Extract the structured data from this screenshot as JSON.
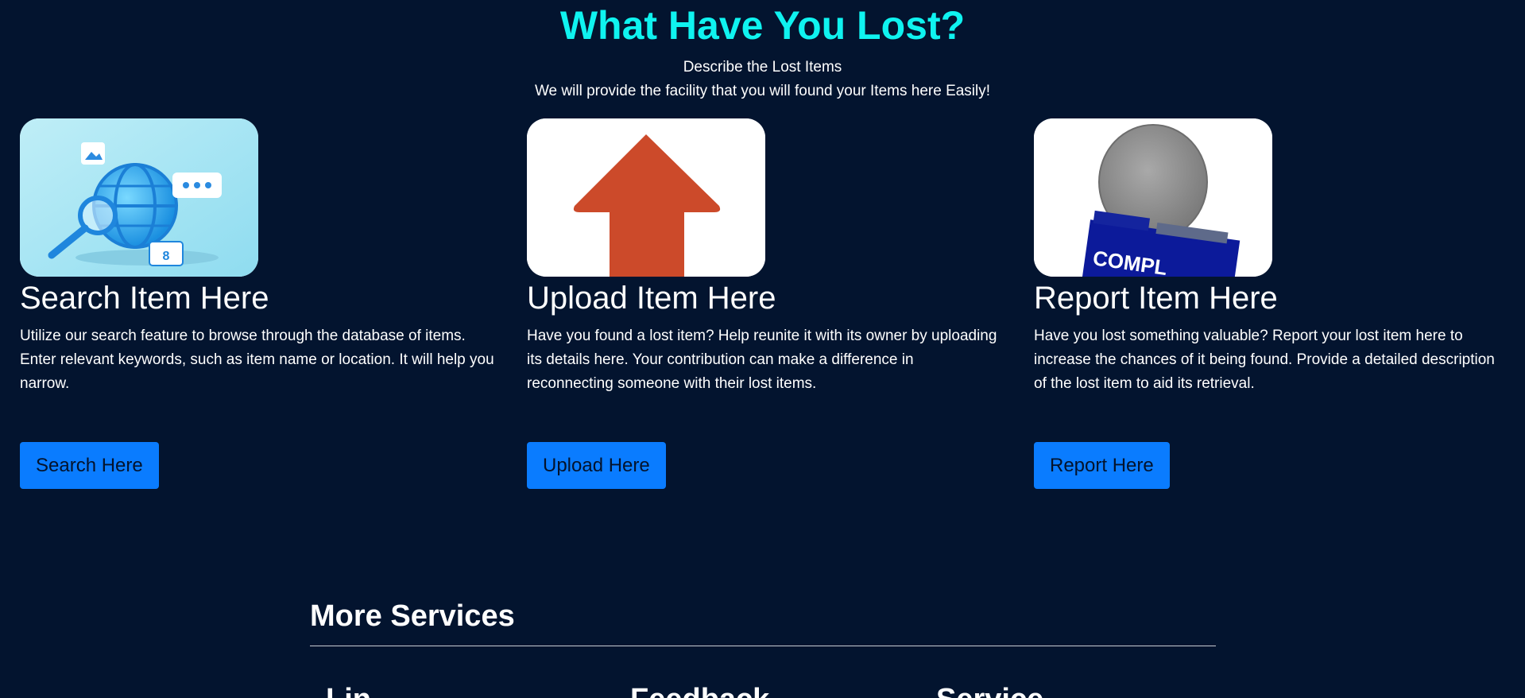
{
  "hero": {
    "title": "What Have You Lost?",
    "subtitle_line1": "Describe the Lost Items",
    "subtitle_line2": "We will provide the facility that you will found your Items here Easily!"
  },
  "cards": [
    {
      "image_icon": "globe-search-illustration",
      "title": "Search Item Here",
      "text": "Utilize our search feature to browse through the database of items. Enter relevant keywords, such as item name or location. It will help you narrow.",
      "button": "Search Here"
    },
    {
      "image_icon": "upload-arrow-illustration",
      "title": "Upload Item Here",
      "text": "Have you found a lost item? Help reunite it with its owner by uploading its details here. Your contribution can make a difference in reconnecting someone with their lost items.",
      "button": "Upload Here"
    },
    {
      "image_icon": "complaint-figure-illustration",
      "title": "Report Item Here",
      "text": "Have you lost something valuable? Report your lost item here to increase the chances of it being found. Provide a detailed description of the lost item to aid its retrieval.",
      "button": "Report Here"
    }
  ],
  "services": {
    "title": "More Services",
    "items": [
      "Lin",
      "Feedback",
      "Service"
    ]
  },
  "colors": {
    "background": "#03142f",
    "accent_title": "#0ff3f0",
    "button": "#0a7cff",
    "upload_arrow": "#cc4a2a"
  }
}
